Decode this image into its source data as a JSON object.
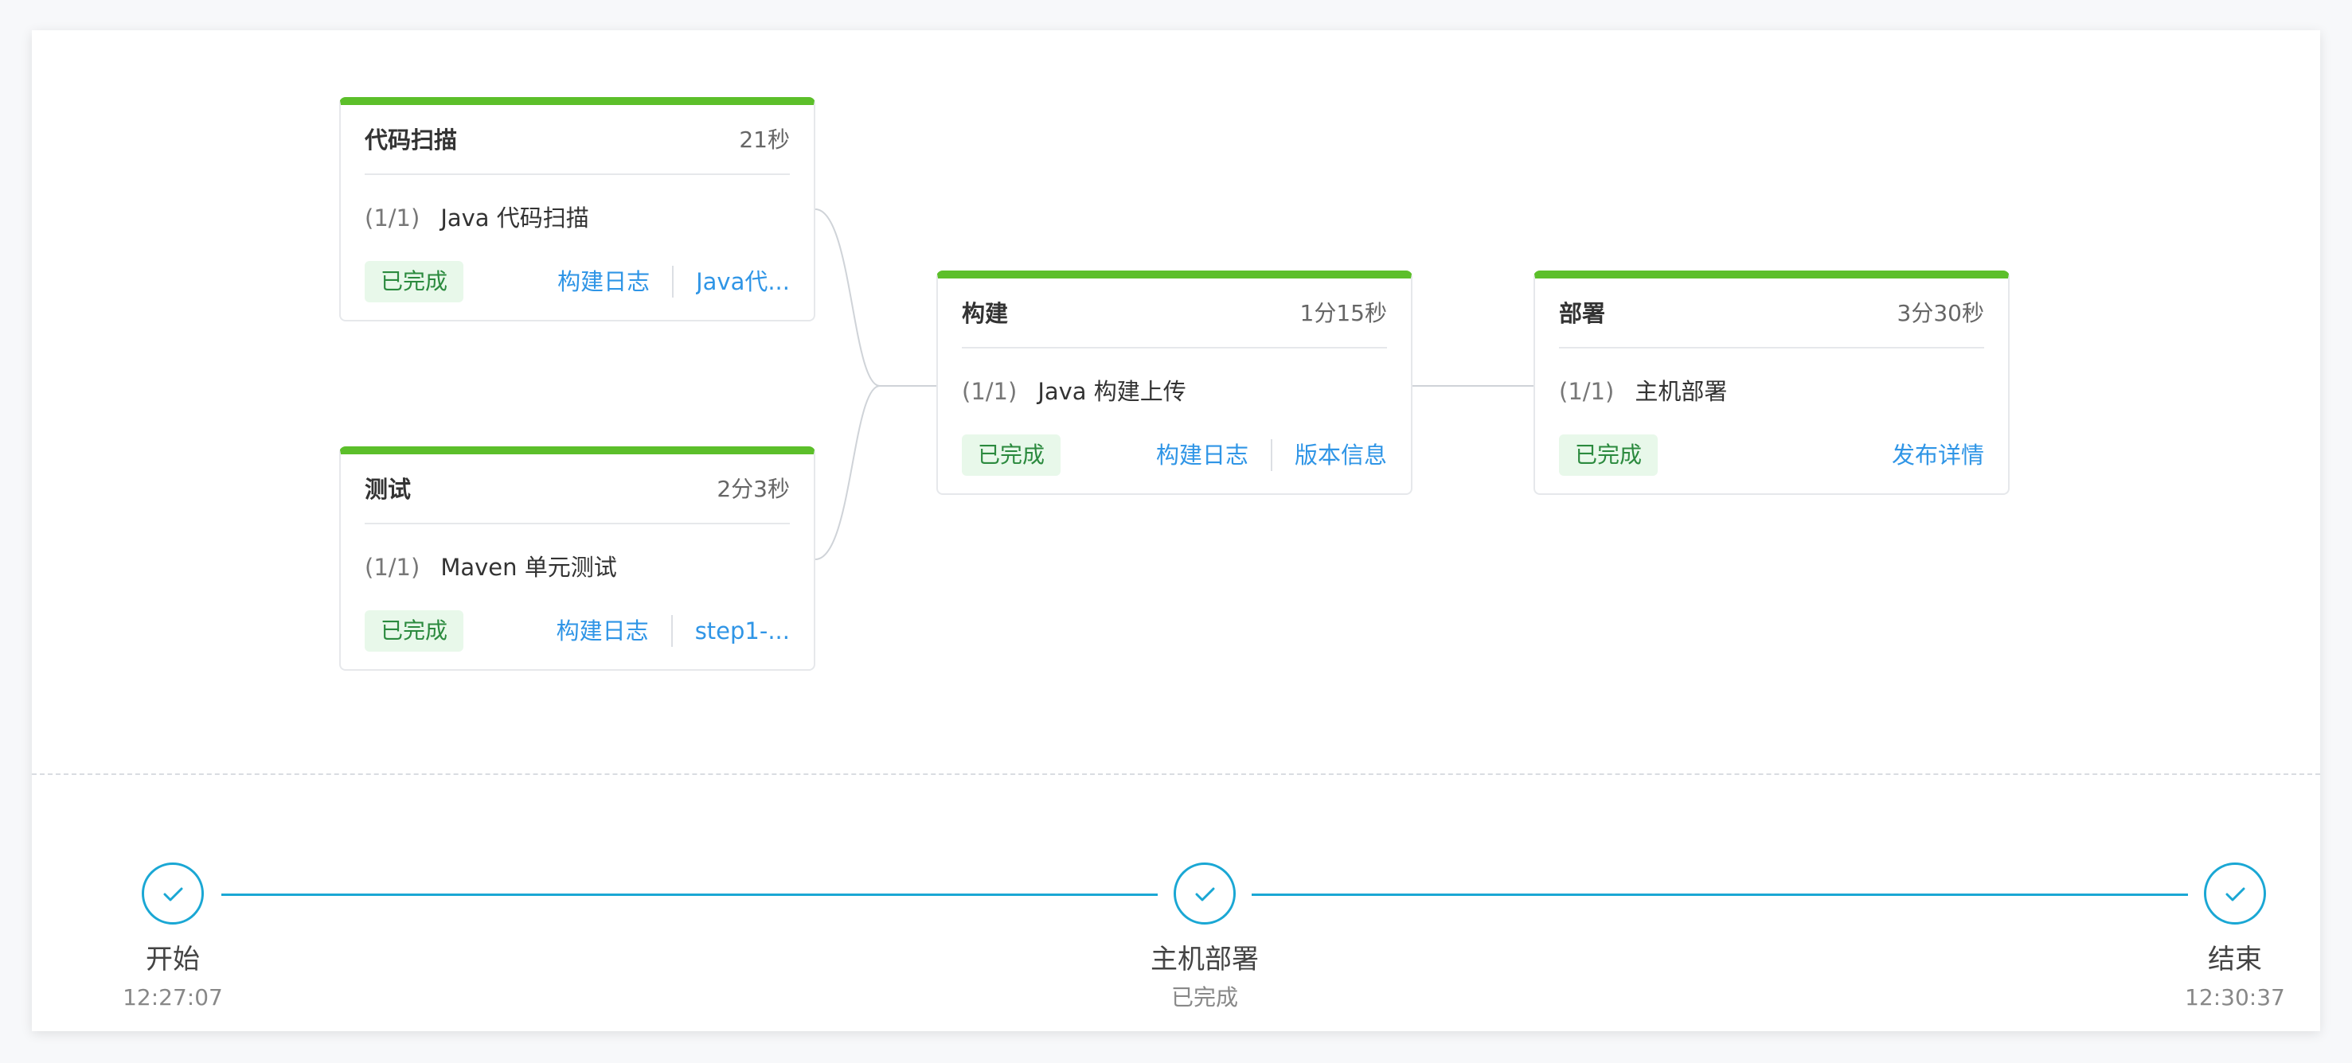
{
  "stages": {
    "scan": {
      "title": "代码扫描",
      "duration": "21秒",
      "task_count": "(1/1)",
      "task_name": "Java 代码扫描",
      "status": "已完成",
      "links": [
        "构建日志",
        "Java代..."
      ]
    },
    "test": {
      "title": "测试",
      "duration": "2分3秒",
      "task_count": "(1/1)",
      "task_name": "Maven 单元测试",
      "status": "已完成",
      "links": [
        "构建日志",
        "step1-..."
      ]
    },
    "build": {
      "title": "构建",
      "duration": "1分15秒",
      "task_count": "(1/1)",
      "task_name": "Java 构建上传",
      "status": "已完成",
      "links": [
        "构建日志",
        "版本信息"
      ]
    },
    "deploy": {
      "title": "部署",
      "duration": "3分30秒",
      "task_count": "(1/1)",
      "task_name": "主机部署",
      "status": "已完成",
      "links": [
        "发布详情"
      ]
    }
  },
  "timeline": {
    "start": {
      "label": "开始",
      "sub": "12:27:07"
    },
    "middle": {
      "label": "主机部署",
      "sub": "已完成"
    },
    "end": {
      "label": "结束",
      "sub": "12:30:37"
    }
  },
  "colors": {
    "success_bar": "#5cbf2a",
    "link": "#2f95e6",
    "timeline": "#1aa7d4",
    "badge_bg": "#e8f8ea",
    "badge_text": "#2b8a3e"
  },
  "icons": {
    "timeline_node": "check-icon"
  }
}
